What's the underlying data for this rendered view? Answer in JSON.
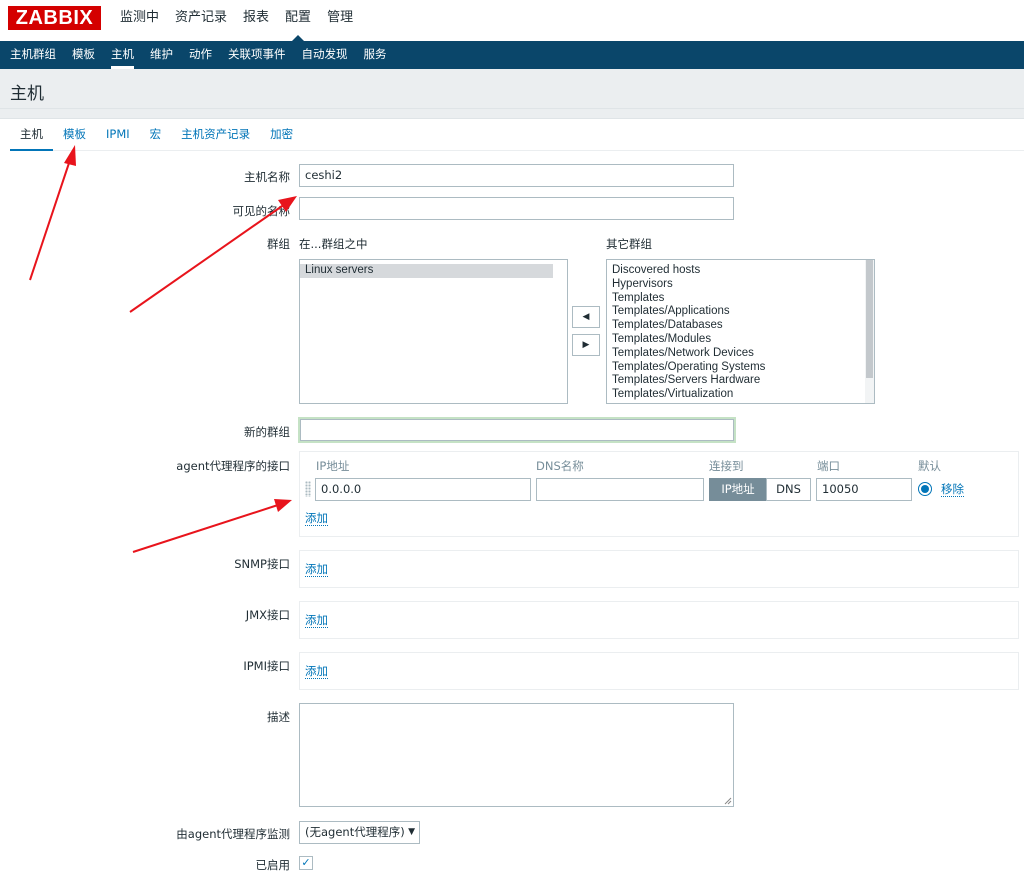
{
  "brand": {
    "logo_text": "ZABBIX"
  },
  "main_menu": [
    "监测中",
    "资产记录",
    "报表",
    "配置",
    "管理"
  ],
  "sub_menu": [
    "主机群组",
    "模板",
    "主机",
    "维护",
    "动作",
    "关联项事件",
    "自动发现",
    "服务"
  ],
  "page_title": "主机",
  "tabs": [
    "主机",
    "模板",
    "IPMI",
    "宏",
    "主机资产记录",
    "加密"
  ],
  "form": {
    "host_name_label": "主机名称",
    "host_name_value": "ceshi2",
    "visible_name_label": "可见的名称",
    "visible_name_value": "",
    "groups_label": "群组",
    "in_groups_label": "在...群组之中",
    "other_groups_label": "其它群组",
    "in_groups": [
      "Linux servers"
    ],
    "other_groups": [
      "Discovered hosts",
      "Hypervisors",
      "Templates",
      "Templates/Applications",
      "Templates/Databases",
      "Templates/Modules",
      "Templates/Network Devices",
      "Templates/Operating Systems",
      "Templates/Servers Hardware",
      "Templates/Virtualization"
    ],
    "move_left_symbol": "◀",
    "move_right_symbol": "▶",
    "new_group_label": "新的群组",
    "new_group_value": "",
    "agent_iface_label": "agent代理程序的接口",
    "iface_columns": {
      "ip": "IP地址",
      "dns": "DNS名称",
      "connect": "连接到",
      "port": "端口",
      "default": "默认"
    },
    "agent_iface": {
      "ip": "0.0.0.0",
      "dns": "",
      "connect_ip": "IP地址",
      "connect_dns": "DNS",
      "port": "10050",
      "remove": "移除"
    },
    "add_label": "添加",
    "snmp_label": "SNMP接口",
    "jmx_label": "JMX接口",
    "ipmi_label": "IPMI接口",
    "description_label": "描述",
    "description_value": "",
    "monitored_by_label": "由agent代理程序监测",
    "monitored_by_value": "(无agent代理程序)",
    "enabled_label": "已启用",
    "enabled_check": "✓"
  },
  "colors": {
    "brand_red": "#d40000",
    "nav_blue": "#0a466a",
    "link_blue": "#0275b8",
    "annotation_red": "#e8141c"
  }
}
